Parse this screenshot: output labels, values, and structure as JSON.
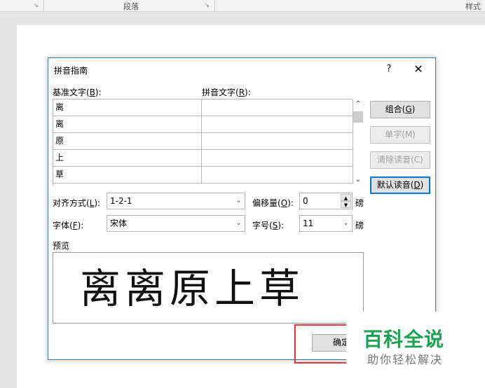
{
  "ribbon": {
    "group_paragraph": "段落",
    "group_styles": "样式"
  },
  "dialog": {
    "title": "拼音指南",
    "help": "?",
    "close": "✕",
    "base_text_label": "基准文字(",
    "base_text_key": "B",
    "base_text_tail": "):",
    "pinyin_label": "拼音文字(",
    "pinyin_key": "R",
    "pinyin_tail": "):",
    "rows": [
      {
        "base": "离",
        "pinyin": ""
      },
      {
        "base": "离",
        "pinyin": ""
      },
      {
        "base": "原",
        "pinyin": ""
      },
      {
        "base": "上",
        "pinyin": ""
      },
      {
        "base": "草",
        "pinyin": ""
      }
    ],
    "buttons": {
      "group": "组合(",
      "group_key": "G",
      "single": "单字(M)",
      "clear": "清除读音(C)",
      "default_read": "默认读音(",
      "default_key": "D"
    },
    "alignment": {
      "label": "对齐方式(",
      "key": "L",
      "tail": "):",
      "value": "1-2-1"
    },
    "offset": {
      "label": "偏移量(",
      "key": "O",
      "tail": "):",
      "value": "0",
      "unit": "磅"
    },
    "font": {
      "label": "字体(",
      "key": "F",
      "tail": "):",
      "value": "宋体"
    },
    "size": {
      "label": "字号(",
      "key": "S",
      "tail": "):",
      "value": "11",
      "unit": "磅"
    },
    "preview_label": "预览",
    "preview_text": "离离原上草",
    "ok": "确定"
  },
  "watermark": {
    "title": "百科全说",
    "subtitle": "助你轻松解决",
    "color": "#1aa250"
  },
  "colors": {
    "highlight": "#e3363b",
    "dialog_border": "#3c7fb1",
    "default_button": "#0078d7"
  }
}
